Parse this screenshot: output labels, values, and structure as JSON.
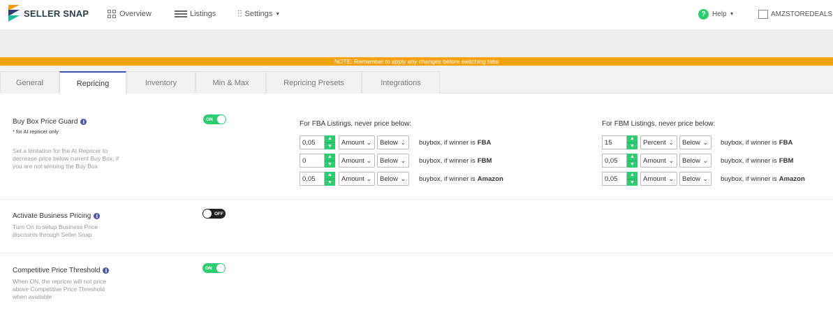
{
  "nav": {
    "brand": "SELLER SNAP",
    "overview": "Overview",
    "listings": "Listings",
    "settings": "Settings",
    "help": "Help",
    "store": "AMZSTOREDEALS"
  },
  "note": "NOTE: Remember to apply any changes before switching tabs",
  "tabs": [
    "General",
    "Repricing",
    "Inventory",
    "Min & Max",
    "Repricing Presets",
    "Integrations"
  ],
  "active_tab": "Repricing",
  "settings": {
    "buybox_guard": {
      "title": "Buy Box Price Guard",
      "note": "* for AI repricer only",
      "desc": "Set a limitation for the AI Repricer to decrease price below current Buy Box, if you are not winning the Buy Box",
      "toggle": "ON"
    },
    "business_pricing": {
      "title": "Activate Business Pricing",
      "desc": "Turn On to setup Business Price discounts through Seller Snap",
      "toggle": "OFF"
    },
    "cpt": {
      "title": "Competitive Price Threshold",
      "desc": "When ON, the repricer will not price above Competitive Price Threshold when available",
      "toggle": "ON"
    }
  },
  "fba": {
    "heading": "For FBA Listings, never price below:",
    "rows": [
      {
        "value": "0,05",
        "type": "Amount",
        "dir": "Below",
        "text": "buybox, if winner is",
        "winner": "FBA"
      },
      {
        "value": "0",
        "type": "Amount",
        "dir": "Below",
        "text": "buybox, if winner is",
        "winner": "FBM"
      },
      {
        "value": "0,05",
        "type": "Amount",
        "dir": "Below",
        "text": "buybox, if winner is",
        "winner": "Amazon"
      }
    ]
  },
  "fbm": {
    "heading": "For FBM Listings, never price below:",
    "rows": [
      {
        "value": "15",
        "type": "Percent",
        "dir": "Below",
        "text": "buybox, if winner is",
        "winner": "FBA"
      },
      {
        "value": "0,05",
        "type": "Amount",
        "dir": "Below",
        "text": "buybox, if winner is",
        "winner": "FBM"
      },
      {
        "value": "0,05",
        "type": "Amount",
        "dir": "Below",
        "text": "buybox, if winner is",
        "winner": "Amazon"
      }
    ]
  },
  "icons": {
    "info": "i",
    "help": "?",
    "up": "▲",
    "down": "▼",
    "caret": "▼",
    "chevron": "⌄"
  }
}
